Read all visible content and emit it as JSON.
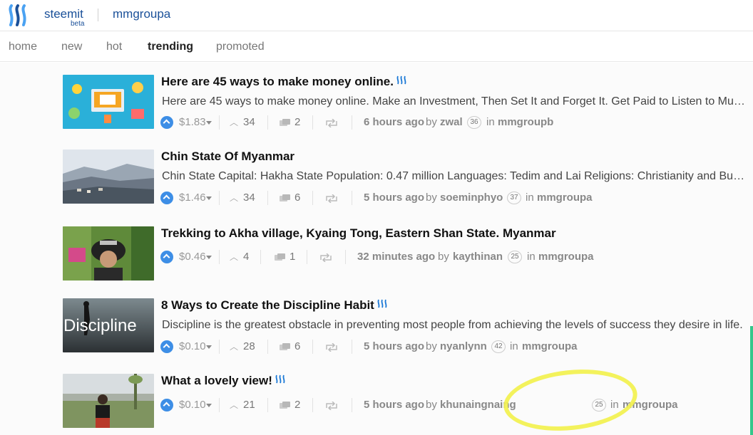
{
  "header": {
    "brand": "steemit",
    "beta": "beta",
    "community": "mmgroupa"
  },
  "nav": {
    "items": [
      "home",
      "new",
      "hot",
      "trending",
      "promoted"
    ],
    "active": "trending"
  },
  "posts": [
    {
      "title": "Here are 45 ways to make money online.",
      "has_steem_icon": true,
      "body": "Here are 45 ways to make money online. Make an Investment, Then Set It and Forget It. Get Paid to Listen to Music.",
      "payout": "$1.83",
      "votes": "34",
      "comments": "2",
      "time": "6 hours ago",
      "by": "by",
      "author": "zwal",
      "reputation": "36",
      "in": "in",
      "category": "mmgroupb"
    },
    {
      "title": "Chin State Of Myanmar",
      "has_steem_icon": false,
      "body": "Chin State Capital: Hakha State Population: 0.47 million Languages: Tedim and Lai Religions: Christianity and Buddhism",
      "payout": "$1.46",
      "votes": "34",
      "comments": "6",
      "time": "5 hours ago",
      "by": "by",
      "author": "soeminphyo",
      "reputation": "37",
      "in": "in",
      "category": "mmgroupa"
    },
    {
      "title": "Trekking to Akha village, Kyaing Tong, Eastern Shan State. Myanmar",
      "has_steem_icon": false,
      "body": "",
      "payout": "$0.46",
      "votes": "4",
      "comments": "1",
      "time": "32 minutes ago",
      "by": "by",
      "author": "kaythinan",
      "reputation": "25",
      "in": "in",
      "category": "mmgroupa"
    },
    {
      "title": "8 Ways to Create the Discipline Habit",
      "has_steem_icon": true,
      "body": "Discipline is the greatest obstacle in preventing most people from achieving the levels of success they desire in life.",
      "payout": "$0.10",
      "votes": "28",
      "comments": "6",
      "time": "5 hours ago",
      "by": "by",
      "author": "nyanlynn",
      "reputation": "42",
      "in": "in",
      "category": "mmgroupa"
    },
    {
      "title": "What a lovely view!",
      "has_steem_icon": true,
      "body": "",
      "payout": "$0.10",
      "votes": "21",
      "comments": "2",
      "time": "5 hours ago",
      "by": "by",
      "author": "khunaingnaing",
      "reputation": "25",
      "in": "in",
      "category": "mmgroupa"
    }
  ],
  "thumb_texts": {
    "discipline": "Discipline"
  },
  "colors": {
    "brand_blue": "#1a5099",
    "upvote_blue": "#3d8ee6",
    "highlight_yellow": "#f2f14e"
  },
  "icons": [
    "steemit-logo-icon",
    "upvote-icon",
    "dropdown-caret-icon",
    "votes-chevron-icon",
    "comments-icon",
    "resteem-icon",
    "steem-waves-icon"
  ]
}
